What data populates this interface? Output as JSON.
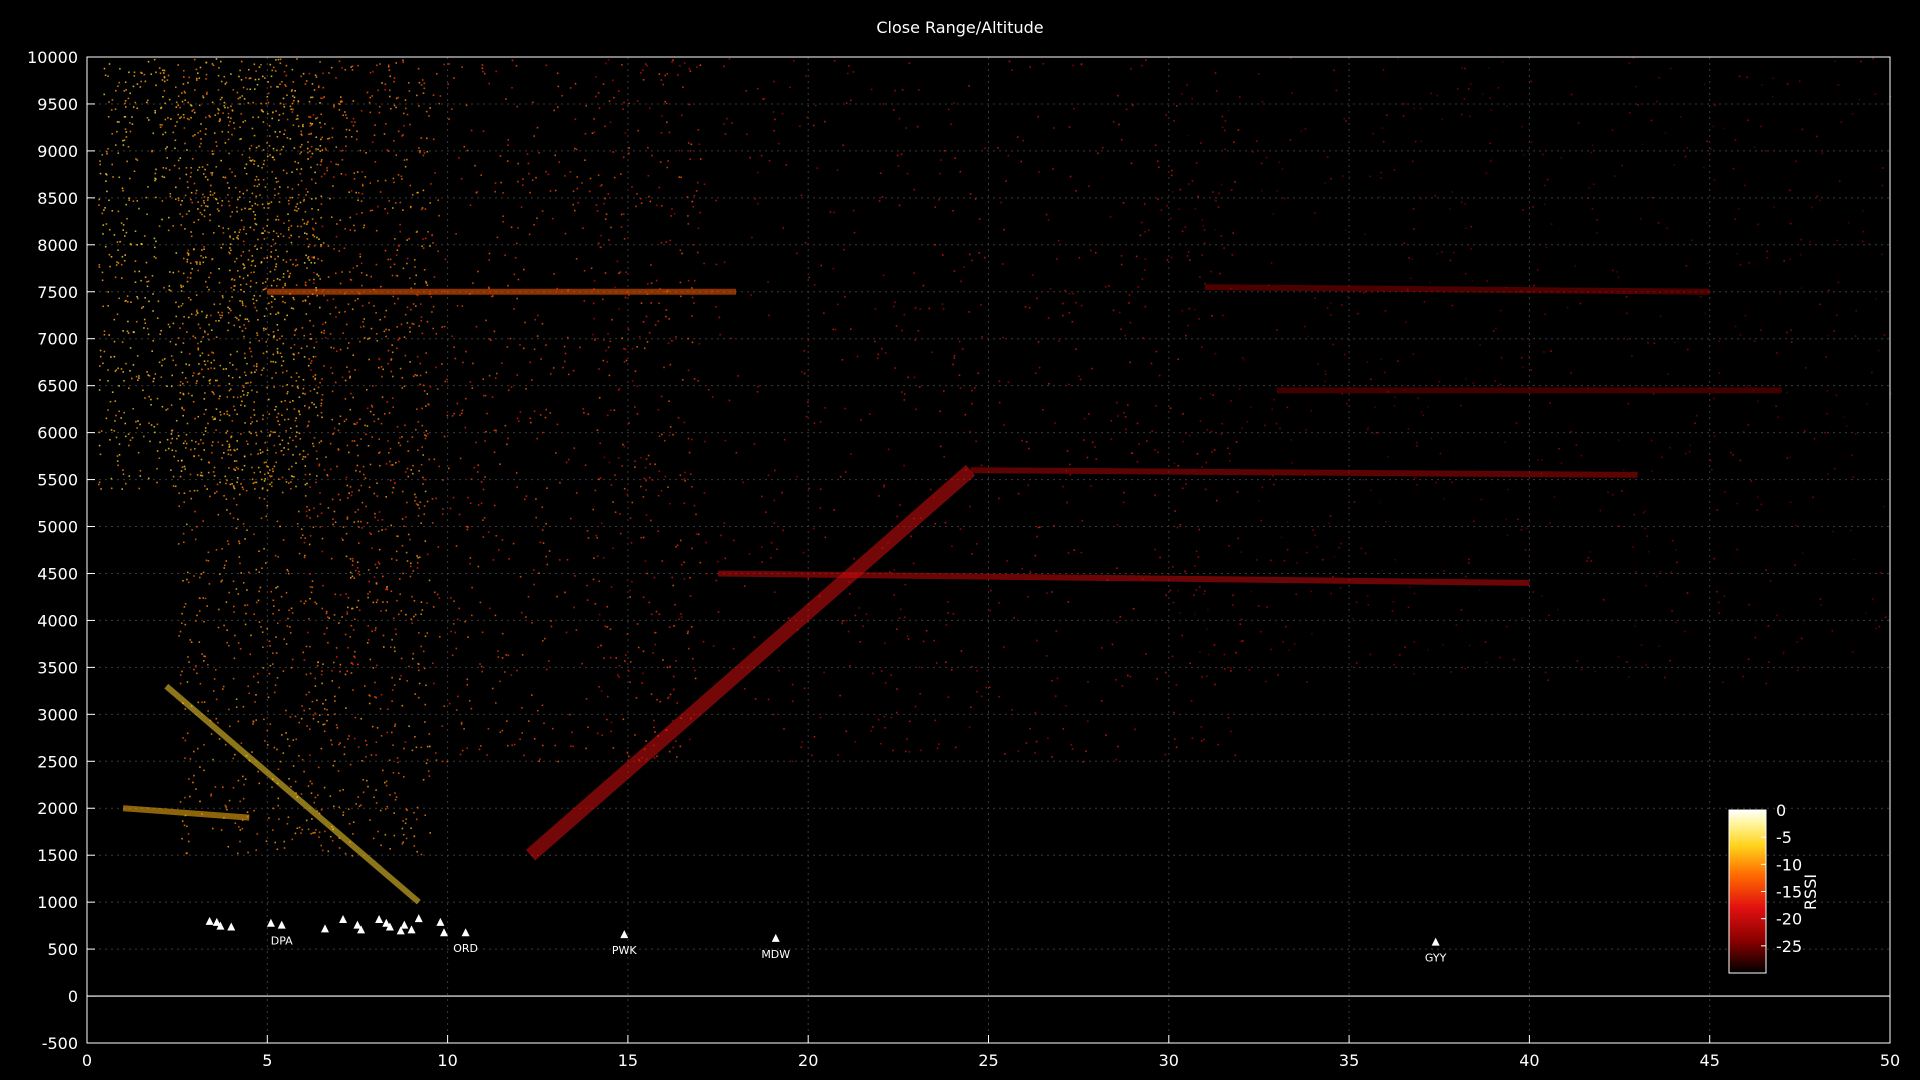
{
  "chart_data": {
    "type": "scatter",
    "title": "Close Range/Altitude",
    "xlim": [
      0,
      50
    ],
    "ylim": [
      -500,
      10000
    ],
    "x_ticks": [
      0,
      5,
      10,
      15,
      20,
      25,
      30,
      35,
      40,
      45,
      50
    ],
    "y_ticks": [
      -500,
      0,
      500,
      1000,
      1500,
      2000,
      2500,
      3000,
      3500,
      4000,
      4500,
      5000,
      5500,
      6000,
      6500,
      7000,
      7500,
      8000,
      8500,
      9000,
      9500,
      10000
    ],
    "grid": true,
    "colorbar": {
      "label": "RSSI",
      "range": [
        -30,
        0
      ],
      "ticks": [
        0,
        -5,
        -10,
        -15,
        -20,
        -25
      ],
      "palette": [
        "#000000",
        "#8b0000",
        "#e11010",
        "#ff6a00",
        "#ffd21a",
        "#fff6a0",
        "#ffffff"
      ]
    },
    "airports": [
      {
        "x": 3.4,
        "y": 800,
        "label": ""
      },
      {
        "x": 3.6,
        "y": 790,
        "label": ""
      },
      {
        "x": 3.7,
        "y": 750,
        "label": ""
      },
      {
        "x": 4.0,
        "y": 740,
        "label": ""
      },
      {
        "x": 5.1,
        "y": 780,
        "label": ""
      },
      {
        "x": 5.4,
        "y": 760,
        "label": "DPA"
      },
      {
        "x": 6.6,
        "y": 720,
        "label": ""
      },
      {
        "x": 7.1,
        "y": 820,
        "label": ""
      },
      {
        "x": 7.5,
        "y": 760,
        "label": ""
      },
      {
        "x": 7.6,
        "y": 710,
        "label": ""
      },
      {
        "x": 8.1,
        "y": 820,
        "label": ""
      },
      {
        "x": 8.3,
        "y": 780,
        "label": ""
      },
      {
        "x": 8.4,
        "y": 740,
        "label": ""
      },
      {
        "x": 8.7,
        "y": 700,
        "label": ""
      },
      {
        "x": 8.8,
        "y": 760,
        "label": ""
      },
      {
        "x": 9.0,
        "y": 710,
        "label": ""
      },
      {
        "x": 9.2,
        "y": 830,
        "label": ""
      },
      {
        "x": 9.8,
        "y": 790,
        "label": ""
      },
      {
        "x": 9.9,
        "y": 680,
        "label": ""
      },
      {
        "x": 10.5,
        "y": 680,
        "label": "ORD"
      },
      {
        "x": 14.9,
        "y": 660,
        "label": "PWK"
      },
      {
        "x": 19.1,
        "y": 620,
        "label": "MDW"
      },
      {
        "x": 37.4,
        "y": 580,
        "label": "GYY"
      }
    ],
    "point_clouds": [
      {
        "x_range": [
          0.3,
          6.5
        ],
        "y_range": [
          5400,
          10000
        ],
        "rssi": -8,
        "density": 0.8
      },
      {
        "x_range": [
          2.5,
          9.5
        ],
        "y_range": [
          1500,
          10000
        ],
        "rssi": -11,
        "density": 1.0
      },
      {
        "x_range": [
          6.0,
          17.0
        ],
        "y_range": [
          2500,
          10000
        ],
        "rssi": -15,
        "density": 0.7
      },
      {
        "x_range": [
          14.0,
          32.0
        ],
        "y_range": [
          2500,
          10000
        ],
        "rssi": -20,
        "density": 0.55
      },
      {
        "x_range": [
          30.0,
          50.0
        ],
        "y_range": [
          3300,
          10000
        ],
        "rssi": -24,
        "density": 0.45
      }
    ],
    "tracks": [
      {
        "points": [
          [
            12.3,
            1500
          ],
          [
            24.5,
            5600
          ]
        ],
        "rssi": -19
      },
      {
        "points": [
          [
            24.5,
            5600
          ],
          [
            43.0,
            5550
          ]
        ],
        "rssi": -22
      },
      {
        "points": [
          [
            17.5,
            4500
          ],
          [
            40.0,
            4400
          ]
        ],
        "rssi": -20
      },
      {
        "points": [
          [
            5.0,
            7500
          ],
          [
            18.0,
            7500
          ]
        ],
        "rssi": -13
      },
      {
        "points": [
          [
            31.0,
            7550
          ],
          [
            45.0,
            7500
          ]
        ],
        "rssi": -24
      },
      {
        "points": [
          [
            33.0,
            6450
          ],
          [
            47.0,
            6450
          ]
        ],
        "rssi": -25
      },
      {
        "points": [
          [
            2.2,
            3300
          ],
          [
            9.2,
            1000
          ]
        ],
        "rssi": -6
      },
      {
        "points": [
          [
            1.0,
            2000
          ],
          [
            4.5,
            1900
          ]
        ],
        "rssi": -8
      }
    ]
  }
}
